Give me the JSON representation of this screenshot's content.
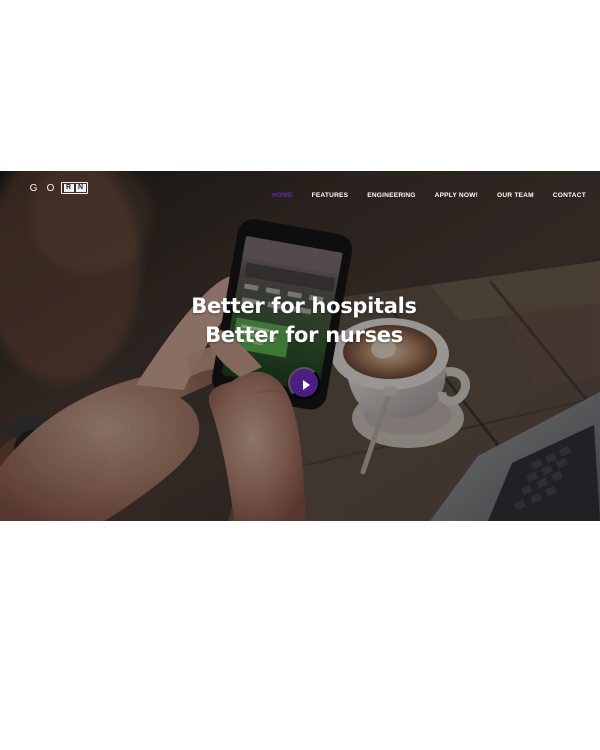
{
  "logo": {
    "letters": [
      "G",
      "O"
    ],
    "box_letters": [
      "R",
      "N"
    ]
  },
  "nav": {
    "items": [
      {
        "label": "HOME",
        "active": true
      },
      {
        "label": "FEATURES",
        "active": false
      },
      {
        "label": "ENGINEERING",
        "active": false
      },
      {
        "label": "APPLY NOW!",
        "active": false
      },
      {
        "label": "OUR TEAM",
        "active": false
      },
      {
        "label": "CONTACT",
        "active": false
      }
    ]
  },
  "hero": {
    "headline_line1": "Better for hospitals",
    "headline_line2": "Better for nurses",
    "play_icon": "play-icon",
    "accent": "#4b1e84"
  }
}
